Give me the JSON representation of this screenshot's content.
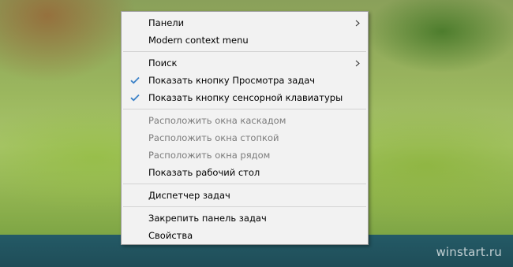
{
  "menu": {
    "items": [
      {
        "label": "Панели"
      },
      {
        "label": "Modern context menu"
      },
      {
        "label": "Поиск"
      },
      {
        "label": "Показать кнопку Просмотра задач"
      },
      {
        "label": "Показать кнопку сенсорной клавиатуры"
      },
      {
        "label": "Расположить окна каскадом"
      },
      {
        "label": "Расположить окна стопкой"
      },
      {
        "label": "Расположить окна рядом"
      },
      {
        "label": "Показать рабочий стол"
      },
      {
        "label": "Диспетчер задач"
      },
      {
        "label": "Закрепить панель задач"
      },
      {
        "label": "Свойства"
      }
    ]
  },
  "watermark": "winstart.ru",
  "icons": {
    "check": "check-icon",
    "submenu": "chevron-right-icon"
  },
  "colors": {
    "check": "#3c82c8",
    "taskbar": "#245a66",
    "menu_bg": "#f2f2f2",
    "disabled_text": "#7c7c7c"
  }
}
